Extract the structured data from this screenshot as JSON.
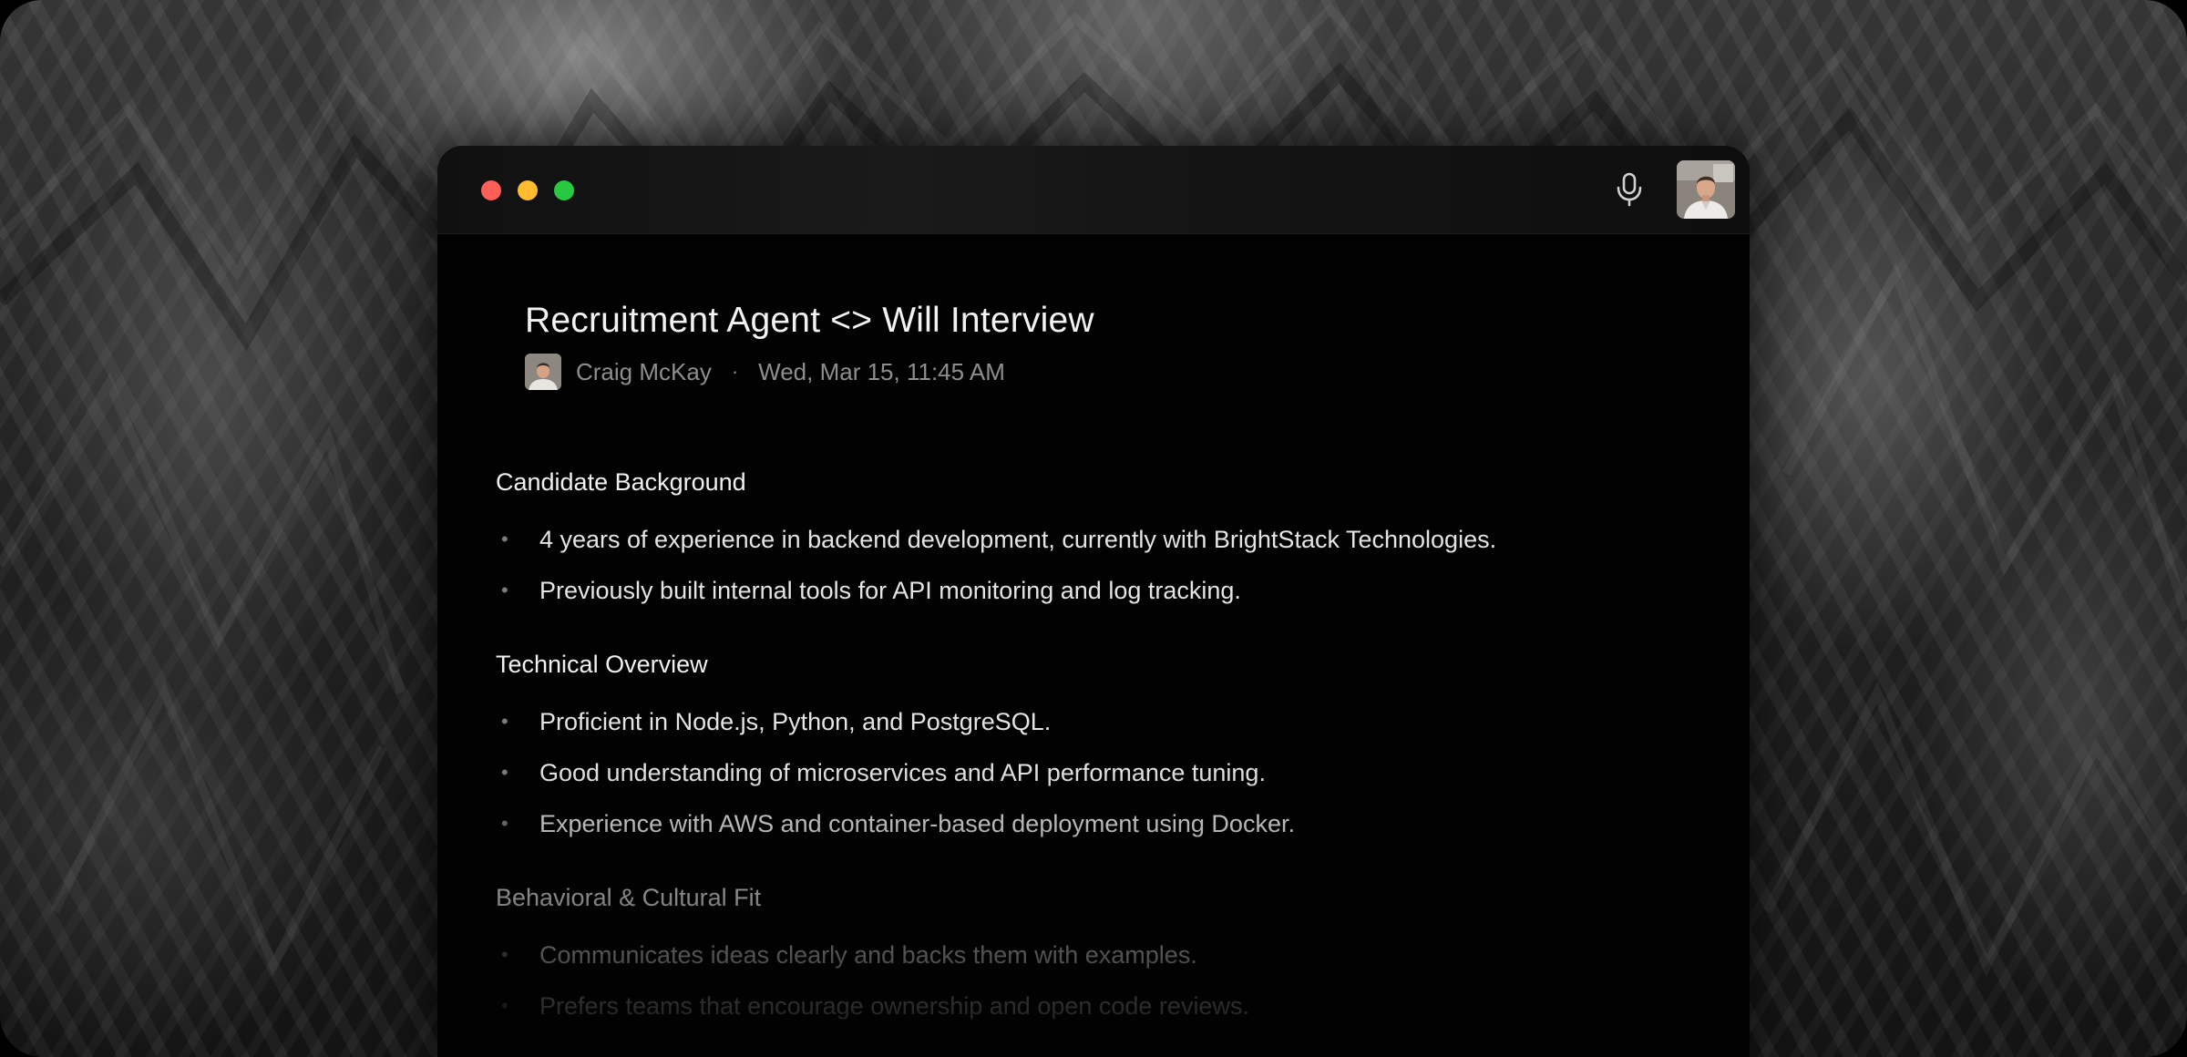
{
  "window": {
    "traffic_lights": [
      "close",
      "minimize",
      "zoom"
    ],
    "colors": {
      "close": "#ff5f57",
      "minimize": "#febc2e",
      "zoom": "#28c840"
    },
    "toolbar_icons": [
      "microphone-icon",
      "camera-thumbnail"
    ]
  },
  "note": {
    "title": "Recruitment Agent <> Will Interview",
    "author": "Craig McKay",
    "separator": "·",
    "datetime": "Wed, Mar 15, 11:45 AM"
  },
  "sections": [
    {
      "title": "Candidate Background",
      "bullets": [
        "4 years of experience in backend development, currently with BrightStack Technologies.",
        "Previously built internal tools for API monitoring and log tracking."
      ]
    },
    {
      "title": "Technical Overview",
      "bullets": [
        "Proficient in Node.js, Python, and PostgreSQL.",
        "Good understanding of microservices and API performance tuning.",
        "Experience with AWS and container-based deployment using Docker."
      ]
    },
    {
      "title": "Behavioral & Cultural Fit",
      "bullets": [
        "Communicates ideas clearly and backs them with examples.",
        "Prefers teams that encourage ownership and open code reviews."
      ]
    }
  ],
  "bullet_mark": "•"
}
